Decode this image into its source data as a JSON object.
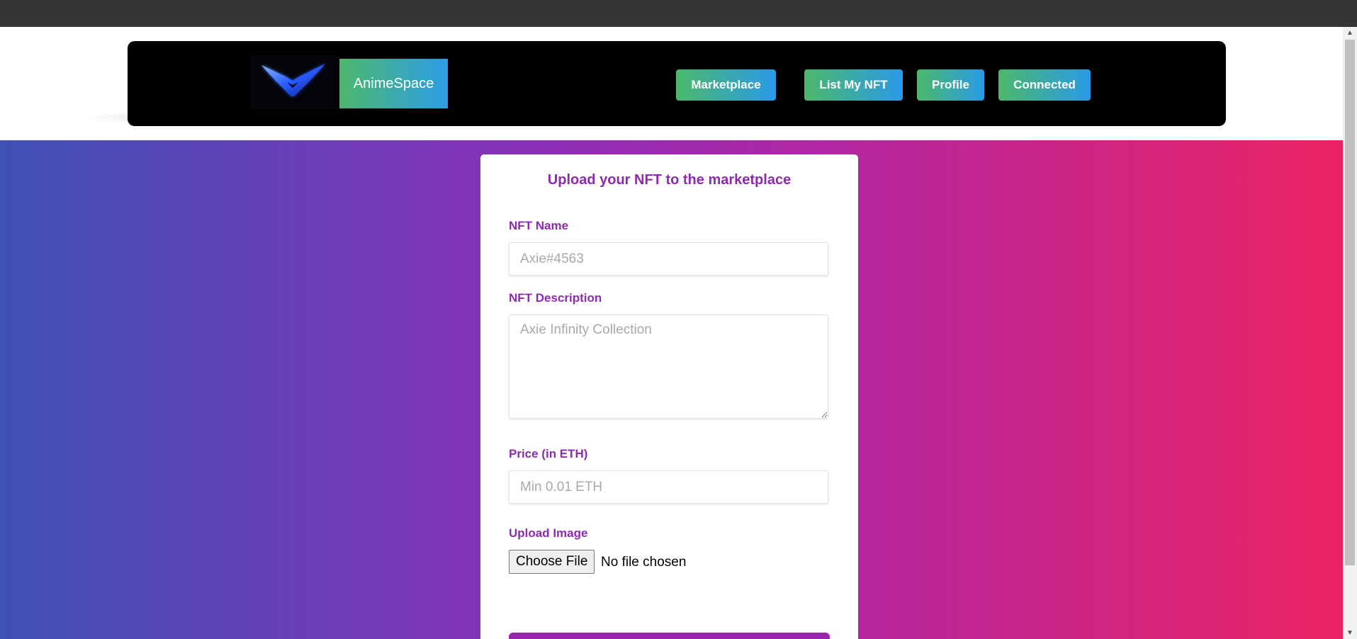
{
  "brand": {
    "logo_icon": "v-chevron-logo-icon",
    "name": "AnimeSpace"
  },
  "nav": {
    "items": [
      {
        "label": "Marketplace"
      },
      {
        "label": "List My NFT"
      },
      {
        "label": "Profile"
      },
      {
        "label": "Connected"
      }
    ]
  },
  "form": {
    "title": "Upload your NFT to the marketplace",
    "name_label": "NFT Name",
    "name_placeholder": "Axie#4563",
    "description_label": "NFT Description",
    "description_placeholder": "Axie Infinity Collection",
    "price_label": "Price (in ETH)",
    "price_placeholder": "Min 0.01 ETH",
    "image_label": "Upload Image",
    "file_button_label": "Choose File",
    "file_status": "No file chosen"
  },
  "colors": {
    "accent_purple": "#8e2ab0",
    "button_gradient_start": "#4cb86b",
    "button_gradient_end": "#2a9ae8",
    "bg_gradient_left": "#3e51b5",
    "bg_gradient_right": "#ea2363"
  }
}
